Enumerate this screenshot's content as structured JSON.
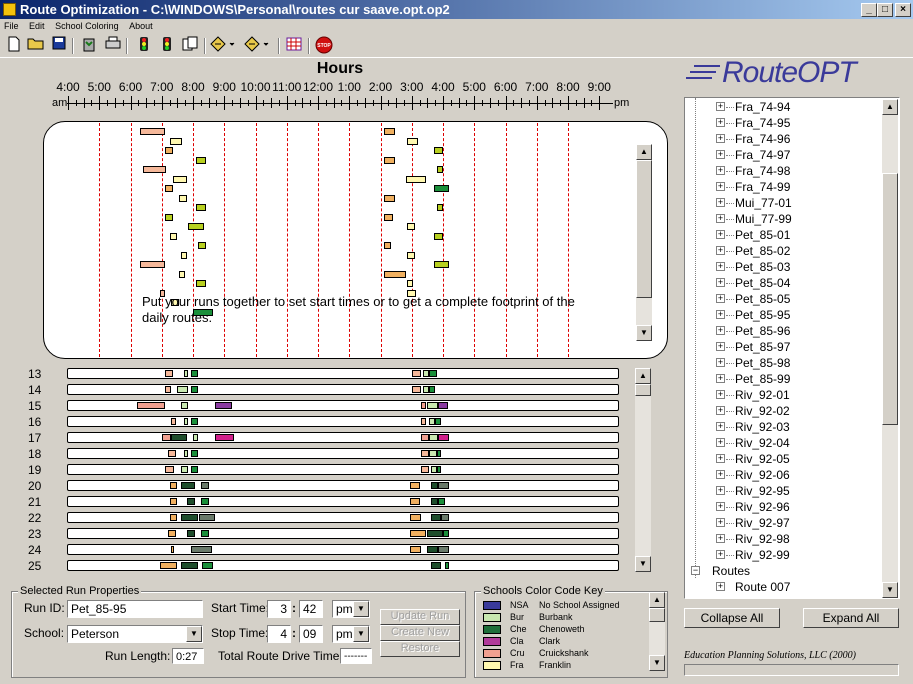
{
  "window": {
    "title": "Route Optimization - C:\\WINDOWS\\Personal\\routes cur saave.opt.op2",
    "minimize": "_",
    "maximize": "□",
    "close": "×"
  },
  "menu": [
    "File",
    "Edit",
    "School Coloring",
    "About"
  ],
  "toolbar": {
    "icons": [
      "new-file-icon",
      "open-folder-icon",
      "save-icon",
      "recycle-icon",
      "print-icon",
      "traffic-light-icon",
      "traffic-light-red-icon",
      "copy-icon",
      "diamond-arrow-icon",
      "diamond-arrow-icon-2",
      "grid-icon",
      "stop-icon"
    ],
    "stop_label": "STOP"
  },
  "timeline": {
    "title": "Hours",
    "am": "am",
    "pm": "pm",
    "hours": [
      "4:00",
      "5:00",
      "6:00",
      "7:00",
      "8:00",
      "9:00",
      "10:00",
      "11:00",
      "12:00",
      "1:00",
      "2:00",
      "3:00",
      "4:00",
      "5:00",
      "6:00",
      "7:00",
      "8:00",
      "9:00"
    ]
  },
  "footprint": {
    "message": "Put your runs together to set start times or to get a complete footprint of the daily routes."
  },
  "colors": {
    "peach": "#f5b89a",
    "salmon": "#f0a090",
    "lightgreen": "#c8e8b0",
    "green": "#1a8f3a",
    "darkgreen": "#1e4d2b",
    "olive": "#b8d020",
    "yellow": "#fff8b0",
    "orange": "#f0b060",
    "magenta": "#d0208a",
    "gray": "#6a7a6a",
    "dusty": "#708070",
    "violet": "#8a3aa0"
  },
  "rows": [
    {
      "label": "13",
      "bars": [
        [
          7.1,
          7.35,
          "peach"
        ],
        [
          7.7,
          7.85,
          "lightgreen"
        ],
        [
          7.95,
          8.15,
          "green"
        ],
        [
          15.0,
          15.3,
          "peach"
        ],
        [
          15.35,
          15.55,
          "lightgreen"
        ],
        [
          15.55,
          15.8,
          "green"
        ]
      ]
    },
    {
      "label": "14",
      "bars": [
        [
          7.1,
          7.3,
          "peach"
        ],
        [
          7.5,
          7.85,
          "lightgreen"
        ],
        [
          7.95,
          8.15,
          "green"
        ],
        [
          15.0,
          15.3,
          "peach"
        ],
        [
          15.35,
          15.55,
          "lightgreen"
        ],
        [
          15.55,
          15.75,
          "green"
        ]
      ]
    },
    {
      "label": "15",
      "bars": [
        [
          6.2,
          7.1,
          "salmon"
        ],
        [
          7.6,
          7.85,
          "lightgreen"
        ],
        [
          8.7,
          9.25,
          "violet"
        ],
        [
          15.3,
          15.45,
          "salmon"
        ],
        [
          15.5,
          15.85,
          "lightgreen"
        ],
        [
          15.85,
          16.15,
          "violet"
        ]
      ]
    },
    {
      "label": "16",
      "bars": [
        [
          7.3,
          7.45,
          "peach"
        ],
        [
          7.7,
          7.85,
          "lightgreen"
        ],
        [
          7.95,
          8.15,
          "green"
        ],
        [
          15.3,
          15.45,
          "peach"
        ],
        [
          15.55,
          15.75,
          "lightgreen"
        ],
        [
          15.75,
          15.95,
          "green"
        ]
      ]
    },
    {
      "label": "17",
      "bars": [
        [
          7.0,
          7.3,
          "salmon"
        ],
        [
          7.3,
          7.8,
          "darkgreen"
        ],
        [
          8.0,
          8.15,
          "lightgreen"
        ],
        [
          8.7,
          9.3,
          "magenta"
        ],
        [
          15.3,
          15.55,
          "salmon"
        ],
        [
          15.55,
          15.85,
          "lightgreen"
        ],
        [
          15.85,
          16.2,
          "magenta"
        ]
      ]
    },
    {
      "label": "18",
      "bars": [
        [
          7.2,
          7.45,
          "peach"
        ],
        [
          7.7,
          7.85,
          "lightgreen"
        ],
        [
          7.95,
          8.15,
          "green"
        ],
        [
          15.3,
          15.55,
          "peach"
        ],
        [
          15.55,
          15.8,
          "lightgreen"
        ],
        [
          15.8,
          15.95,
          "green"
        ]
      ]
    },
    {
      "label": "19",
      "bars": [
        [
          7.1,
          7.4,
          "peach"
        ],
        [
          7.6,
          7.85,
          "lightgreen"
        ],
        [
          7.95,
          8.15,
          "green"
        ],
        [
          15.3,
          15.55,
          "peach"
        ],
        [
          15.6,
          15.8,
          "lightgreen"
        ],
        [
          15.8,
          15.95,
          "green"
        ]
      ]
    },
    {
      "label": "20",
      "bars": [
        [
          7.25,
          7.5,
          "orange"
        ],
        [
          7.6,
          8.05,
          "darkgreen"
        ],
        [
          8.25,
          8.5,
          "gray"
        ],
        [
          14.95,
          15.25,
          "orange"
        ],
        [
          15.6,
          15.85,
          "darkgreen"
        ],
        [
          15.85,
          16.2,
          "gray"
        ]
      ]
    },
    {
      "label": "21",
      "bars": [
        [
          7.25,
          7.5,
          "orange"
        ],
        [
          7.8,
          8.05,
          "darkgreen"
        ],
        [
          8.25,
          8.5,
          "green"
        ],
        [
          14.95,
          15.25,
          "orange"
        ],
        [
          15.6,
          15.85,
          "darkgreen"
        ],
        [
          15.85,
          16.05,
          "green"
        ]
      ]
    },
    {
      "label": "22",
      "bars": [
        [
          7.25,
          7.5,
          "orange"
        ],
        [
          7.6,
          8.15,
          "darkgreen"
        ],
        [
          8.2,
          8.7,
          "gray"
        ],
        [
          14.95,
          15.3,
          "orange"
        ],
        [
          15.6,
          15.95,
          "darkgreen"
        ],
        [
          15.95,
          16.2,
          "gray"
        ]
      ]
    },
    {
      "label": "23",
      "bars": [
        [
          7.2,
          7.45,
          "orange"
        ],
        [
          7.8,
          8.05,
          "darkgreen"
        ],
        [
          8.25,
          8.5,
          "green"
        ],
        [
          14.95,
          15.45,
          "orange"
        ],
        [
          15.5,
          16.0,
          "darkgreen"
        ],
        [
          16.0,
          16.2,
          "green"
        ]
      ]
    },
    {
      "label": "24",
      "bars": [
        [
          7.3,
          7.4,
          "orange"
        ],
        [
          7.95,
          8.6,
          "gray"
        ],
        [
          14.95,
          15.3,
          "orange"
        ],
        [
          15.5,
          15.85,
          "darkgreen"
        ],
        [
          15.85,
          16.2,
          "gray"
        ]
      ]
    },
    {
      "label": "25",
      "bars": [
        [
          6.95,
          7.5,
          "orange"
        ],
        [
          7.6,
          8.15,
          "darkgreen"
        ],
        [
          8.3,
          8.65,
          "green"
        ],
        [
          15.6,
          15.95,
          "darkgreen"
        ],
        [
          16.05,
          16.2,
          "green"
        ]
      ]
    }
  ],
  "footprint_bars": [
    [
      6.3,
      7.1,
      "peach",
      0
    ],
    [
      7.25,
      7.65,
      "yellow",
      1
    ],
    [
      7.1,
      7.35,
      "orange",
      2
    ],
    [
      8.1,
      8.4,
      "olive",
      3
    ],
    [
      6.4,
      7.15,
      "peach",
      4
    ],
    [
      7.35,
      7.8,
      "yellow",
      5
    ],
    [
      7.1,
      7.35,
      "orange",
      6
    ],
    [
      7.55,
      7.8,
      "yellow",
      7
    ],
    [
      8.1,
      8.4,
      "olive",
      8
    ],
    [
      7.1,
      7.35,
      "olive",
      9
    ],
    [
      7.85,
      8.35,
      "olive",
      10
    ],
    [
      7.25,
      7.5,
      "yellow",
      11
    ],
    [
      8.15,
      8.4,
      "olive",
      12
    ],
    [
      7.6,
      7.8,
      "yellow",
      13
    ],
    [
      6.3,
      7.1,
      "peach",
      14
    ],
    [
      7.55,
      7.75,
      "yellow",
      15
    ],
    [
      8.1,
      8.4,
      "olive",
      16
    ],
    [
      6.95,
      7.1,
      "peach",
      17
    ],
    [
      7.3,
      7.55,
      "yellow",
      18
    ],
    [
      8.0,
      8.65,
      "green",
      19
    ],
    [
      14.1,
      14.45,
      "orange",
      0
    ],
    [
      14.85,
      15.2,
      "yellow",
      1
    ],
    [
      15.7,
      16.0,
      "olive",
      2
    ],
    [
      14.1,
      14.45,
      "orange",
      3
    ],
    [
      15.8,
      16.0,
      "olive",
      4
    ],
    [
      14.8,
      15.45,
      "yellow",
      5
    ],
    [
      15.7,
      16.2,
      "green",
      6
    ],
    [
      14.1,
      14.45,
      "orange",
      7
    ],
    [
      15.8,
      16.0,
      "olive",
      8
    ],
    [
      14.1,
      14.4,
      "orange",
      9
    ],
    [
      14.85,
      15.1,
      "yellow",
      10
    ],
    [
      15.7,
      16.0,
      "olive",
      11
    ],
    [
      14.1,
      14.35,
      "orange",
      12
    ],
    [
      14.85,
      15.1,
      "yellow",
      13
    ],
    [
      15.7,
      16.2,
      "olive",
      14
    ],
    [
      14.1,
      14.8,
      "orange",
      15
    ],
    [
      14.85,
      15.05,
      "yellow",
      16
    ],
    [
      14.85,
      15.15,
      "yellow",
      17
    ]
  ],
  "properties": {
    "group_title": "Selected Run Properties",
    "run_id_label": "Run ID:",
    "run_id": "Pet_85-95",
    "school_label": "School:",
    "school": "Peterson",
    "run_length_label": "Run Length:",
    "run_length": "0:27",
    "start_label": "Start Time:",
    "start_hour": "3",
    "start_min": "42",
    "start_ampm": "pm",
    "stop_label": "Stop Time:",
    "stop_hour": "4",
    "stop_min": "09",
    "stop_ampm": "pm",
    "drive_label": "Total Route Drive Time:",
    "drive_value": "-------",
    "update_btn": "Update Run",
    "create_btn": "Create New",
    "restore_btn": "Restore"
  },
  "schools": {
    "group_title": "Schools Color Code Key",
    "items": [
      {
        "code": "NSA",
        "name": "No School Assigned",
        "color": "#3a3a9a"
      },
      {
        "code": "Bur",
        "name": "Burbank",
        "color": "#c8e8b0"
      },
      {
        "code": "Che",
        "name": "Chenoweth",
        "color": "#1e6e3a"
      },
      {
        "code": "Cla",
        "name": "Clark",
        "color": "#b03a9a"
      },
      {
        "code": "Cru",
        "name": "Cruickshank",
        "color": "#f0a090"
      },
      {
        "code": "Fra",
        "name": "Franklin",
        "color": "#fff8b0"
      }
    ]
  },
  "logo": {
    "text": "RouteOPT"
  },
  "tree": {
    "items": [
      "Fra_74-94",
      "Fra_74-95",
      "Fra_74-96",
      "Fra_74-97",
      "Fra_74-98",
      "Fra_74-99",
      "Mui_77-01",
      "Mui_77-99",
      "Pet_85-01",
      "Pet_85-02",
      "Pet_85-03",
      "Pet_85-04",
      "Pet_85-05",
      "Pet_85-95",
      "Pet_85-96",
      "Pet_85-97",
      "Pet_85-98",
      "Pet_85-99",
      "Riv_92-01",
      "Riv_92-02",
      "Riv_92-03",
      "Riv_92-04",
      "Riv_92-05",
      "Riv_92-06",
      "Riv_92-95",
      "Riv_92-96",
      "Riv_92-97",
      "Riv_92-98",
      "Riv_92-99"
    ],
    "routes_label": "Routes",
    "route_item": "Route 007"
  },
  "collapse_btn": "Collapse All",
  "expand_btn": "Expand All",
  "company": "Education Planning Solutions, LLC   (2000)"
}
